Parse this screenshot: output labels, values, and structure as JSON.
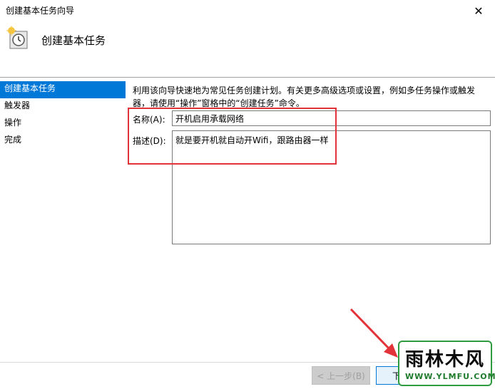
{
  "window": {
    "title": "创建基本任务向导",
    "close_glyph": "✕"
  },
  "header": {
    "title": "创建基本任务",
    "icon": "scheduler-clock-icon"
  },
  "steps": [
    {
      "label": "创建基本任务",
      "active": true
    },
    {
      "label": "触发器",
      "active": false
    },
    {
      "label": "操作",
      "active": false
    },
    {
      "label": "完成",
      "active": false
    }
  ],
  "content": {
    "description": "利用该向导快速地为常见任务创建计划。有关更多高级选项或设置，例如多任务操作或触发器，请使用“操作”窗格中的“创建任务”命令。",
    "name_label": "名称(A):",
    "name_value": "开机启用承载网络",
    "desc_label": "描述(D):",
    "desc_value": "就是要开机就自动开Wifi，跟路由器一样"
  },
  "buttons": {
    "back": "< 上一步(B)",
    "next": "下一步"
  },
  "annotation_color": "#e3333a",
  "accent_color": "#0078d7",
  "watermark": {
    "main": "雨林木风",
    "url": "WWW.YLMFU.COM"
  }
}
